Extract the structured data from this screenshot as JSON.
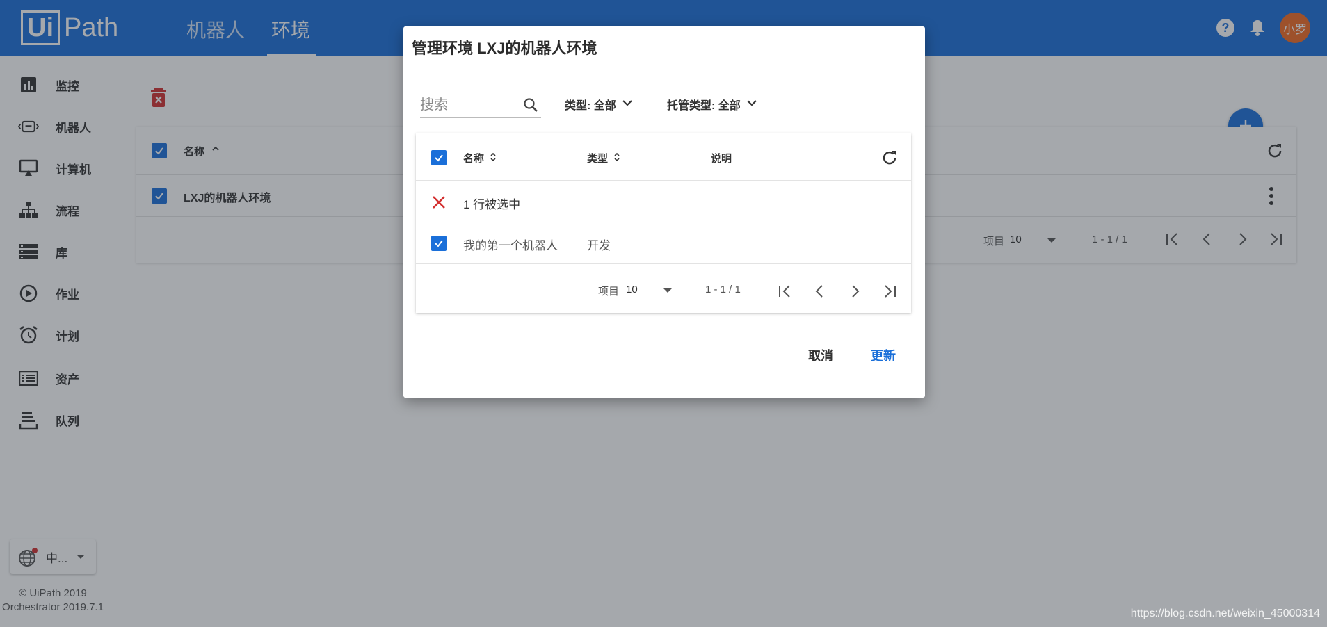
{
  "header": {
    "logo_box": "Ui",
    "logo_rest": "Path",
    "tabs": [
      {
        "label": "机器人",
        "active": false
      },
      {
        "label": "环境",
        "active": true
      }
    ],
    "avatar_text": "小罗"
  },
  "sidebar": {
    "items": [
      {
        "label": "监控",
        "icon": "chart-icon"
      },
      {
        "label": "机器人",
        "icon": "robot-icon"
      },
      {
        "label": "计算机",
        "icon": "monitor-icon"
      },
      {
        "label": "流程",
        "icon": "process-icon"
      },
      {
        "label": "库",
        "icon": "library-icon"
      },
      {
        "label": "作业",
        "icon": "play-icon"
      },
      {
        "label": "计划",
        "icon": "alarm-icon"
      },
      {
        "label": "资产",
        "icon": "asset-icon"
      },
      {
        "label": "队列",
        "icon": "queue-icon"
      }
    ],
    "language_label": "中...",
    "footer_line1": "© UiPath 2019",
    "footer_line2": "Orchestrator 2019.7.1"
  },
  "main": {
    "column_name": "名称",
    "row_name": "LXJ的机器人环境",
    "items_label": "项目",
    "items_value": "10",
    "range": "1 - 1 / 1"
  },
  "dialog": {
    "title": "管理环境 LXJ的机器人环境",
    "search_placeholder": "搜索",
    "filter_type": "类型: 全部",
    "filter_hosting": "托管类型: 全部",
    "columns": {
      "name": "名称",
      "type": "类型",
      "description": "说明"
    },
    "selected_text": "1 行被选中",
    "rows": [
      {
        "name": "我的第一个机器人",
        "type": "开发",
        "description": ""
      }
    ],
    "items_label": "项目",
    "items_value": "10",
    "range": "1 - 1 / 1",
    "cancel_label": "取消",
    "update_label": "更新"
  },
  "watermark": "https://blog.csdn.net/weixin_45000314",
  "colors": {
    "primary": "#1a6fd9",
    "avatar": "#f26a21",
    "danger": "#d32f2f"
  }
}
